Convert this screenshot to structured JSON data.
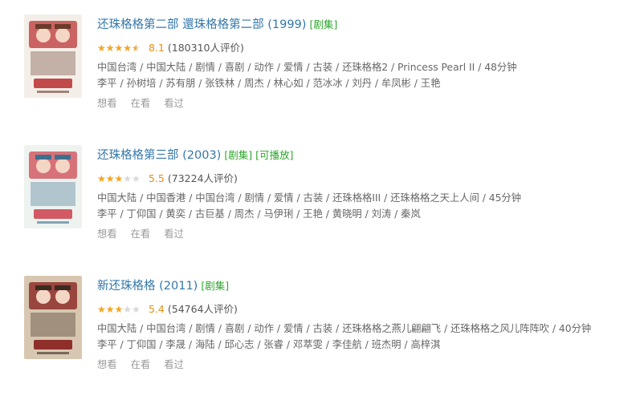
{
  "items": [
    {
      "title": "还珠格格第二部 還珠格格第二部 (1999)",
      "tags": [
        "[剧集]"
      ],
      "rating": 8.1,
      "score": "8.1",
      "votes": "(180310人评价)",
      "info": "中国台湾 / 中国大陆 / 剧情 / 喜剧 / 动作 / 爱情 / 古装 / 还珠格格2 / Princess Pearl II / 48分钟",
      "cast": "李平 / 孙树培 / 苏有朋 / 张铁林 / 周杰 / 林心如 / 范冰冰 / 刘丹 / 牟凤彬 / 王艳",
      "actions": [
        "想看",
        "在看",
        "看过"
      ],
      "poster_colors": [
        "#f3efe8",
        "#c34a4a",
        "#6a3b2b"
      ]
    },
    {
      "title": "还珠格格第三部 (2003)",
      "tags": [
        "[剧集]",
        "[可播放]"
      ],
      "rating": 5.5,
      "score": "5.5",
      "votes": "(73224人评价)",
      "info": "中国大陆 / 中国香港 / 中国台湾 / 剧情 / 爱情 / 古装 / 还珠格格III / 还珠格格之天上人间 / 45分钟",
      "cast": "李平 / 丁仰国 / 黄奕 / 古巨基 / 周杰 / 马伊琍 / 王艳 / 黄晓明 / 刘涛 / 秦岚",
      "actions": [
        "想看",
        "在看",
        "看过"
      ],
      "poster_colors": [
        "#eef3f0",
        "#d35a64",
        "#3e6f8f"
      ]
    },
    {
      "title": "新还珠格格 (2011)",
      "tags": [
        "[剧集]"
      ],
      "rating": 5.4,
      "score": "5.4",
      "votes": "(54764人评价)",
      "info": "中国大陆 / 中国台湾 / 剧情 / 喜剧 / 动作 / 爱情 / 古装 / 还珠格格之燕儿翩翩飞 / 还珠格格之风儿阵阵吹 / 40分钟",
      "cast": "李平 / 丁仰国 / 李晟 / 海陆 / 邱心志 / 张睿 / 邓萃雯 / 李佳航 / 班杰明 / 高梓淇",
      "actions": [
        "想看",
        "在看",
        "看过"
      ],
      "poster_colors": [
        "#d8c7b0",
        "#8e2f2a",
        "#3b2a20"
      ]
    }
  ]
}
